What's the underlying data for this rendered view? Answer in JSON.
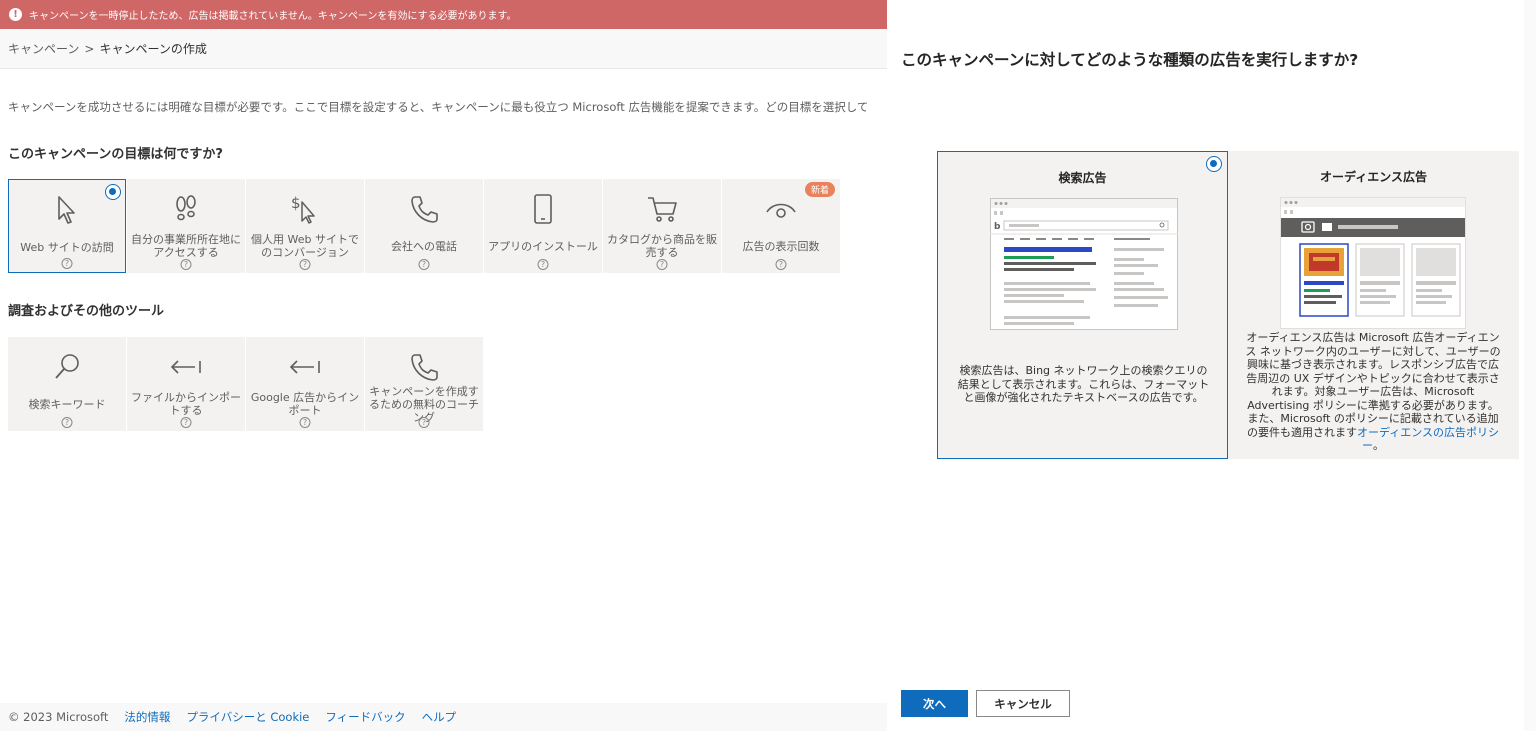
{
  "banner": {
    "icon": "error-icon",
    "text": "キャンペーンを一時停止したため、広告は掲載されていません。キャンペーンを有効にする必要があります。"
  },
  "breadcrumb": {
    "root": "キャンペーン",
    "separator": ">",
    "current": "キャンペーンの作成"
  },
  "intro": "キャンペーンを成功させるには明確な目標が必要です。ここで目標を設定すると、キャンペーンに最も役立つ Microsoft 広告機能を提案できます。どの目標を選択して",
  "goals": {
    "heading": "このキャンペーンの目標は何ですか?",
    "items": [
      {
        "label": "Web サイトの訪問",
        "icon": "cursor-icon",
        "selected": true
      },
      {
        "label": "自分の事業所所在地にアクセスする",
        "icon": "footsteps-icon"
      },
      {
        "label": "個人用 Web サイトでのコンバージョン",
        "icon": "dollar-cursor-icon"
      },
      {
        "label": "会社への電話",
        "icon": "phone-icon"
      },
      {
        "label": "アプリのインストール",
        "icon": "mobile-icon"
      },
      {
        "label": "カタログから商品を販売する",
        "icon": "cart-icon"
      },
      {
        "label": "広告の表示回数",
        "icon": "eye-icon",
        "badge": "新着"
      }
    ],
    "help": "?"
  },
  "tools": {
    "heading": "調査およびその他のツール",
    "items": [
      {
        "label": "検索キーワード",
        "icon": "search-icon"
      },
      {
        "label": "ファイルからインポートする",
        "icon": "import-arrow-icon"
      },
      {
        "label": "Google 広告からインポート",
        "icon": "import-arrow-icon"
      },
      {
        "label": "キャンペーンを作成するための無料のコーチング",
        "icon": "phone-icon"
      }
    ]
  },
  "footer": {
    "copyright": "© 2023 Microsoft",
    "links": [
      "法的情報",
      "プライバシーと Cookie",
      "フィードバック",
      "ヘルプ"
    ]
  },
  "panel": {
    "title": "このキャンペーンに対してどのような種類の広告を実行しますか?",
    "cards": [
      {
        "title": "検索広告",
        "selected": true,
        "description": "検索広告は、Bing ネットワーク上の検索クエリの結果として表示されます。これらは、フォーマットと画像が強化されたテキストベースの広告です。"
      },
      {
        "title": "オーディエンス広告",
        "selected": false,
        "description": "オーディエンス広告は Microsoft 広告オーディエンス ネットワーク内のユーザーに対して、ユーザーの興味に基づき表示されます。レスポンシブ広告で広告周辺の UX デザインやトピックに合わせて表示されます。対象ユーザー広告は、Microsoft Advertising ポリシーに準拠する必要があります。また、Microsoft のポリシーに記載されている追加の要件も適用されます",
        "link": "オーディエンスの広告ポリシー",
        "suffix": "。"
      }
    ],
    "next": "次へ",
    "cancel": "キャンセル"
  },
  "colors": {
    "accent": "#0f6cbd",
    "banner": "#d06767",
    "badge": "#e8825d",
    "bing_blue": "#2b49c7",
    "green": "#1e9e55",
    "audience_orange": "#e8a23a",
    "audience_red": "#c0392b"
  }
}
